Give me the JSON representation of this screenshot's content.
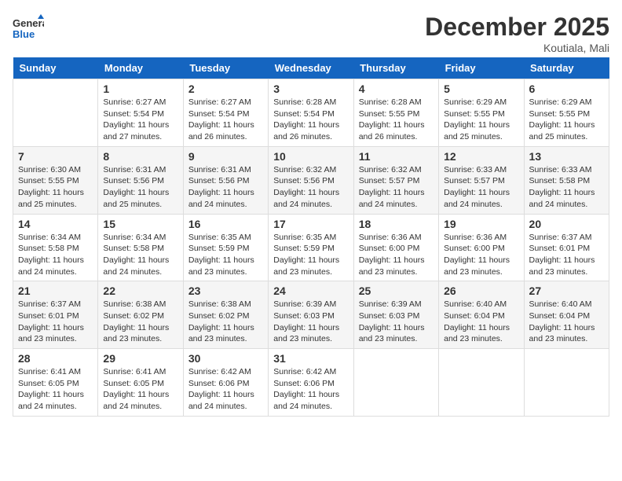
{
  "header": {
    "logo_general": "General",
    "logo_blue": "Blue",
    "month_title": "December 2025",
    "location": "Koutiala, Mali"
  },
  "days_of_week": [
    "Sunday",
    "Monday",
    "Tuesday",
    "Wednesday",
    "Thursday",
    "Friday",
    "Saturday"
  ],
  "weeks": [
    [
      {
        "num": "",
        "sunrise": "",
        "sunset": "",
        "daylight": ""
      },
      {
        "num": "1",
        "sunrise": "Sunrise: 6:27 AM",
        "sunset": "Sunset: 5:54 PM",
        "daylight": "Daylight: 11 hours and 27 minutes."
      },
      {
        "num": "2",
        "sunrise": "Sunrise: 6:27 AM",
        "sunset": "Sunset: 5:54 PM",
        "daylight": "Daylight: 11 hours and 26 minutes."
      },
      {
        "num": "3",
        "sunrise": "Sunrise: 6:28 AM",
        "sunset": "Sunset: 5:54 PM",
        "daylight": "Daylight: 11 hours and 26 minutes."
      },
      {
        "num": "4",
        "sunrise": "Sunrise: 6:28 AM",
        "sunset": "Sunset: 5:55 PM",
        "daylight": "Daylight: 11 hours and 26 minutes."
      },
      {
        "num": "5",
        "sunrise": "Sunrise: 6:29 AM",
        "sunset": "Sunset: 5:55 PM",
        "daylight": "Daylight: 11 hours and 25 minutes."
      },
      {
        "num": "6",
        "sunrise": "Sunrise: 6:29 AM",
        "sunset": "Sunset: 5:55 PM",
        "daylight": "Daylight: 11 hours and 25 minutes."
      }
    ],
    [
      {
        "num": "7",
        "sunrise": "Sunrise: 6:30 AM",
        "sunset": "Sunset: 5:55 PM",
        "daylight": "Daylight: 11 hours and 25 minutes."
      },
      {
        "num": "8",
        "sunrise": "Sunrise: 6:31 AM",
        "sunset": "Sunset: 5:56 PM",
        "daylight": "Daylight: 11 hours and 25 minutes."
      },
      {
        "num": "9",
        "sunrise": "Sunrise: 6:31 AM",
        "sunset": "Sunset: 5:56 PM",
        "daylight": "Daylight: 11 hours and 24 minutes."
      },
      {
        "num": "10",
        "sunrise": "Sunrise: 6:32 AM",
        "sunset": "Sunset: 5:56 PM",
        "daylight": "Daylight: 11 hours and 24 minutes."
      },
      {
        "num": "11",
        "sunrise": "Sunrise: 6:32 AM",
        "sunset": "Sunset: 5:57 PM",
        "daylight": "Daylight: 11 hours and 24 minutes."
      },
      {
        "num": "12",
        "sunrise": "Sunrise: 6:33 AM",
        "sunset": "Sunset: 5:57 PM",
        "daylight": "Daylight: 11 hours and 24 minutes."
      },
      {
        "num": "13",
        "sunrise": "Sunrise: 6:33 AM",
        "sunset": "Sunset: 5:58 PM",
        "daylight": "Daylight: 11 hours and 24 minutes."
      }
    ],
    [
      {
        "num": "14",
        "sunrise": "Sunrise: 6:34 AM",
        "sunset": "Sunset: 5:58 PM",
        "daylight": "Daylight: 11 hours and 24 minutes."
      },
      {
        "num": "15",
        "sunrise": "Sunrise: 6:34 AM",
        "sunset": "Sunset: 5:58 PM",
        "daylight": "Daylight: 11 hours and 24 minutes."
      },
      {
        "num": "16",
        "sunrise": "Sunrise: 6:35 AM",
        "sunset": "Sunset: 5:59 PM",
        "daylight": "Daylight: 11 hours and 23 minutes."
      },
      {
        "num": "17",
        "sunrise": "Sunrise: 6:35 AM",
        "sunset": "Sunset: 5:59 PM",
        "daylight": "Daylight: 11 hours and 23 minutes."
      },
      {
        "num": "18",
        "sunrise": "Sunrise: 6:36 AM",
        "sunset": "Sunset: 6:00 PM",
        "daylight": "Daylight: 11 hours and 23 minutes."
      },
      {
        "num": "19",
        "sunrise": "Sunrise: 6:36 AM",
        "sunset": "Sunset: 6:00 PM",
        "daylight": "Daylight: 11 hours and 23 minutes."
      },
      {
        "num": "20",
        "sunrise": "Sunrise: 6:37 AM",
        "sunset": "Sunset: 6:01 PM",
        "daylight": "Daylight: 11 hours and 23 minutes."
      }
    ],
    [
      {
        "num": "21",
        "sunrise": "Sunrise: 6:37 AM",
        "sunset": "Sunset: 6:01 PM",
        "daylight": "Daylight: 11 hours and 23 minutes."
      },
      {
        "num": "22",
        "sunrise": "Sunrise: 6:38 AM",
        "sunset": "Sunset: 6:02 PM",
        "daylight": "Daylight: 11 hours and 23 minutes."
      },
      {
        "num": "23",
        "sunrise": "Sunrise: 6:38 AM",
        "sunset": "Sunset: 6:02 PM",
        "daylight": "Daylight: 11 hours and 23 minutes."
      },
      {
        "num": "24",
        "sunrise": "Sunrise: 6:39 AM",
        "sunset": "Sunset: 6:03 PM",
        "daylight": "Daylight: 11 hours and 23 minutes."
      },
      {
        "num": "25",
        "sunrise": "Sunrise: 6:39 AM",
        "sunset": "Sunset: 6:03 PM",
        "daylight": "Daylight: 11 hours and 23 minutes."
      },
      {
        "num": "26",
        "sunrise": "Sunrise: 6:40 AM",
        "sunset": "Sunset: 6:04 PM",
        "daylight": "Daylight: 11 hours and 23 minutes."
      },
      {
        "num": "27",
        "sunrise": "Sunrise: 6:40 AM",
        "sunset": "Sunset: 6:04 PM",
        "daylight": "Daylight: 11 hours and 23 minutes."
      }
    ],
    [
      {
        "num": "28",
        "sunrise": "Sunrise: 6:41 AM",
        "sunset": "Sunset: 6:05 PM",
        "daylight": "Daylight: 11 hours and 24 minutes."
      },
      {
        "num": "29",
        "sunrise": "Sunrise: 6:41 AM",
        "sunset": "Sunset: 6:05 PM",
        "daylight": "Daylight: 11 hours and 24 minutes."
      },
      {
        "num": "30",
        "sunrise": "Sunrise: 6:42 AM",
        "sunset": "Sunset: 6:06 PM",
        "daylight": "Daylight: 11 hours and 24 minutes."
      },
      {
        "num": "31",
        "sunrise": "Sunrise: 6:42 AM",
        "sunset": "Sunset: 6:06 PM",
        "daylight": "Daylight: 11 hours and 24 minutes."
      },
      {
        "num": "",
        "sunrise": "",
        "sunset": "",
        "daylight": ""
      },
      {
        "num": "",
        "sunrise": "",
        "sunset": "",
        "daylight": ""
      },
      {
        "num": "",
        "sunrise": "",
        "sunset": "",
        "daylight": ""
      }
    ]
  ]
}
